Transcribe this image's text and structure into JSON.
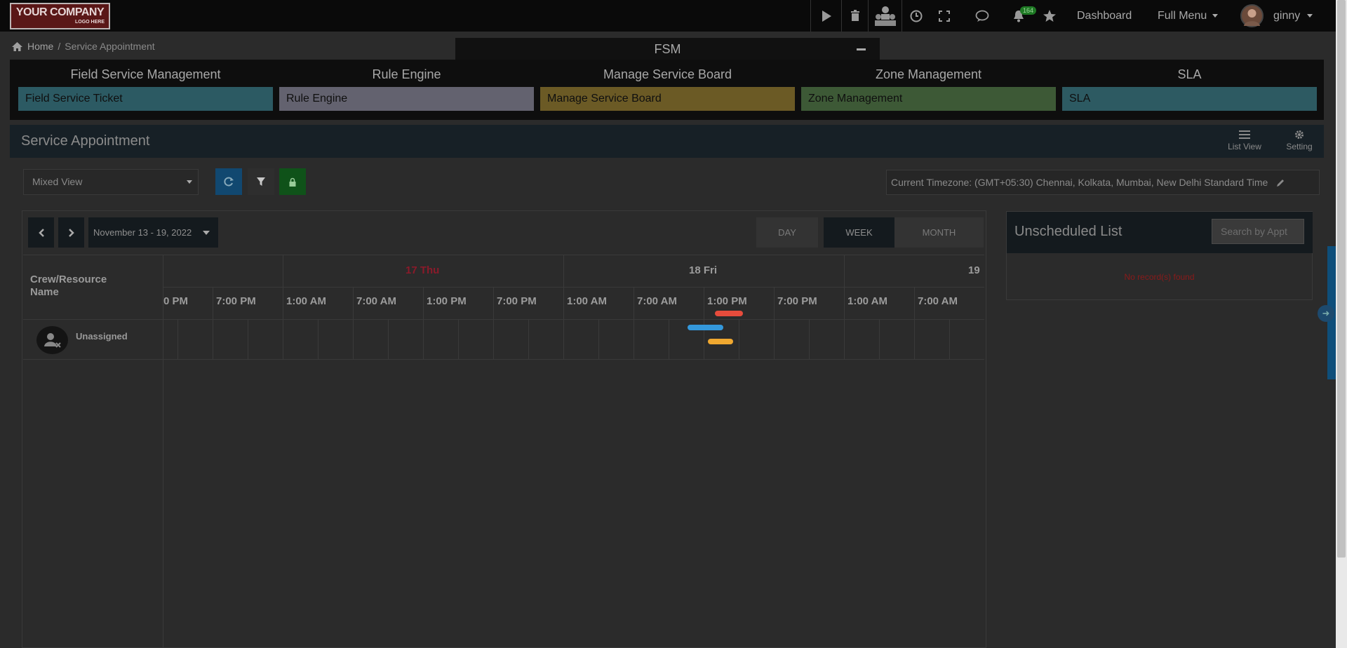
{
  "logo": {
    "line1": "YOUR COMPANY",
    "line2": "LOGO HERE"
  },
  "topbar": {
    "notif_count": "164",
    "dashboard_label": "Dashboard",
    "fullmenu_label": "Full Menu",
    "username": "ginny"
  },
  "breadcrumb": {
    "home": "Home",
    "separator": "/",
    "current": "Service Appointment"
  },
  "fsm_tab": {
    "label": "FSM"
  },
  "modules": [
    {
      "heading": "Field Service Management",
      "button": "Field Service Ticket",
      "color": "#2c5a63"
    },
    {
      "heading": "Rule Engine",
      "button": "Rule Engine",
      "color": "#63626f"
    },
    {
      "heading": "Manage Service Board",
      "button": "Manage Service Board",
      "color": "#6b5a25"
    },
    {
      "heading": "Zone Management",
      "button": "Zone Management",
      "color": "#3d5936"
    },
    {
      "heading": "SLA",
      "button": "SLA",
      "color": "#2d5a62"
    }
  ],
  "panel": {
    "title": "Service Appointment",
    "list_view": "List View",
    "setting": "Setting"
  },
  "toolbar": {
    "view_select": "Mixed View",
    "timezone": "Current Timezone: (GMT+05:30) Chennai, Kolkata, Mumbai, New Delhi Standard Time"
  },
  "calendar": {
    "date_range": "November 13 - 19, 2022",
    "views": [
      "DAY",
      "WEEK",
      "MONTH"
    ],
    "active_view": "WEEK",
    "crew_header_line1": "Crew/Resource",
    "crew_header_line2": "Name",
    "days": [
      "17 Thu",
      "18 Fri",
      "19"
    ],
    "hours": [
      "0 PM",
      "7:00 PM",
      "1:00 AM",
      "7:00 AM",
      "1:00 PM",
      "7:00 PM",
      "1:00 AM",
      "7:00 AM",
      "1:00 PM",
      "7:00 PM",
      "1:00 AM",
      "7:00 AM"
    ],
    "resource": "Unassigned",
    "event_colors": [
      "#e74c3c",
      "#3498db",
      "#f0a830"
    ]
  },
  "unscheduled": {
    "title": "Unscheduled List",
    "search_placeholder": "Search by Appt",
    "empty": "No record(s) found"
  }
}
